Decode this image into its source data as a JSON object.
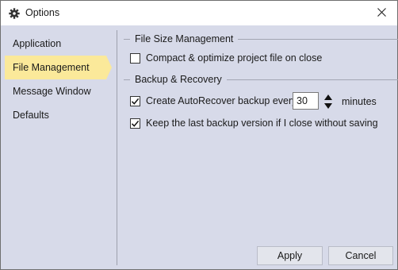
{
  "window": {
    "title": "Options",
    "title_icon": "gear-icon",
    "close_icon": "close-icon"
  },
  "sidebar": {
    "items": [
      {
        "label": "Application",
        "selected": false
      },
      {
        "label": "File Management",
        "selected": true
      },
      {
        "label": "Message Window",
        "selected": false
      },
      {
        "label": "Defaults",
        "selected": false
      }
    ]
  },
  "file_size": {
    "header": "File Size Management",
    "compact": {
      "label": "Compact & optimize project file on close",
      "checked": false
    }
  },
  "backup": {
    "header": "Backup & Recovery",
    "autorecover": {
      "label": "Create AutoRecover backup every",
      "checked": true,
      "value": "30",
      "unit": "minutes"
    },
    "keep_last": {
      "label": "Keep the last backup version if I close without saving",
      "checked": true
    }
  },
  "buttons": {
    "apply": "Apply",
    "cancel": "Cancel"
  },
  "colors": {
    "selected_bg": "#fbe99a",
    "panel_bg": "#d7dae9"
  }
}
